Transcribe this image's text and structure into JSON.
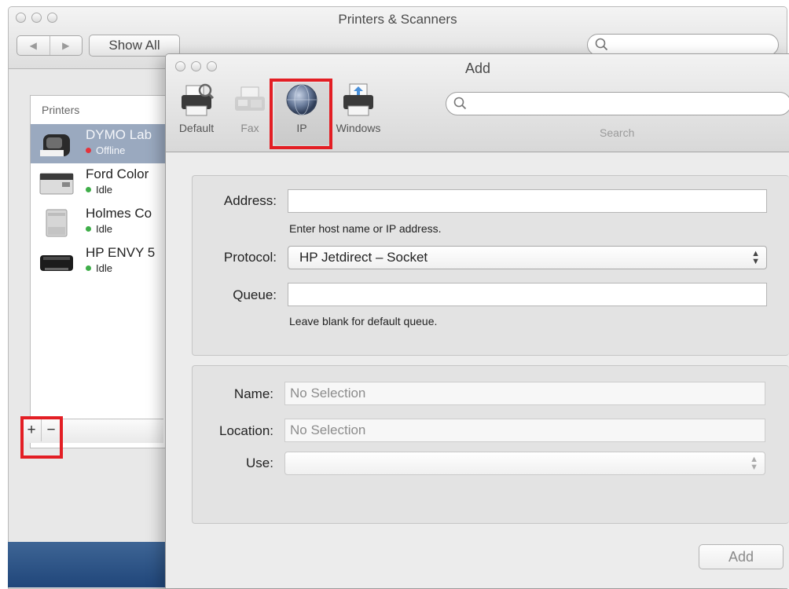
{
  "background_window": {
    "title": "Printers & Scanners",
    "nav_back": "◀",
    "nav_forward": "▶",
    "show_all_label": "Show All",
    "printers_header": "Printers",
    "printers": [
      {
        "name": "DYMO Lab",
        "status": "Offline",
        "status_color": "#e5333b",
        "selected": true
      },
      {
        "name": "Ford Color",
        "status": "Idle",
        "status_color": "#3fae49",
        "selected": false
      },
      {
        "name": "Holmes Co",
        "status": "Idle",
        "status_color": "#3fae49",
        "selected": false
      },
      {
        "name": "HP ENVY 5",
        "status": "Idle",
        "status_color": "#3fae49",
        "selected": false
      }
    ],
    "add_printer_label": "+",
    "remove_printer_label": "−"
  },
  "add_window": {
    "title": "Add",
    "toolbar": [
      {
        "label": "Default",
        "icon": "default-printer-icon",
        "selected": false
      },
      {
        "label": "Fax",
        "icon": "fax-icon",
        "selected": false
      },
      {
        "label": "IP",
        "icon": "ip-globe-icon",
        "selected": true
      },
      {
        "label": "Windows",
        "icon": "windows-printer-icon",
        "selected": false
      }
    ],
    "search_caption": "Search",
    "search_value": "",
    "form": {
      "address_label": "Address:",
      "address_value": "",
      "address_hint": "Enter host name or IP address.",
      "protocol_label": "Protocol:",
      "protocol_value": "HP Jetdirect – Socket",
      "queue_label": "Queue:",
      "queue_value": "",
      "queue_hint": "Leave blank for default queue."
    },
    "details": {
      "name_label": "Name:",
      "name_placeholder": "No Selection",
      "location_label": "Location:",
      "location_placeholder": "No Selection",
      "use_label": "Use:",
      "use_value": ""
    },
    "add_button_label": "Add"
  },
  "colors": {
    "highlight_red": "#e31e24",
    "selected_row": "#9aa9bf"
  }
}
